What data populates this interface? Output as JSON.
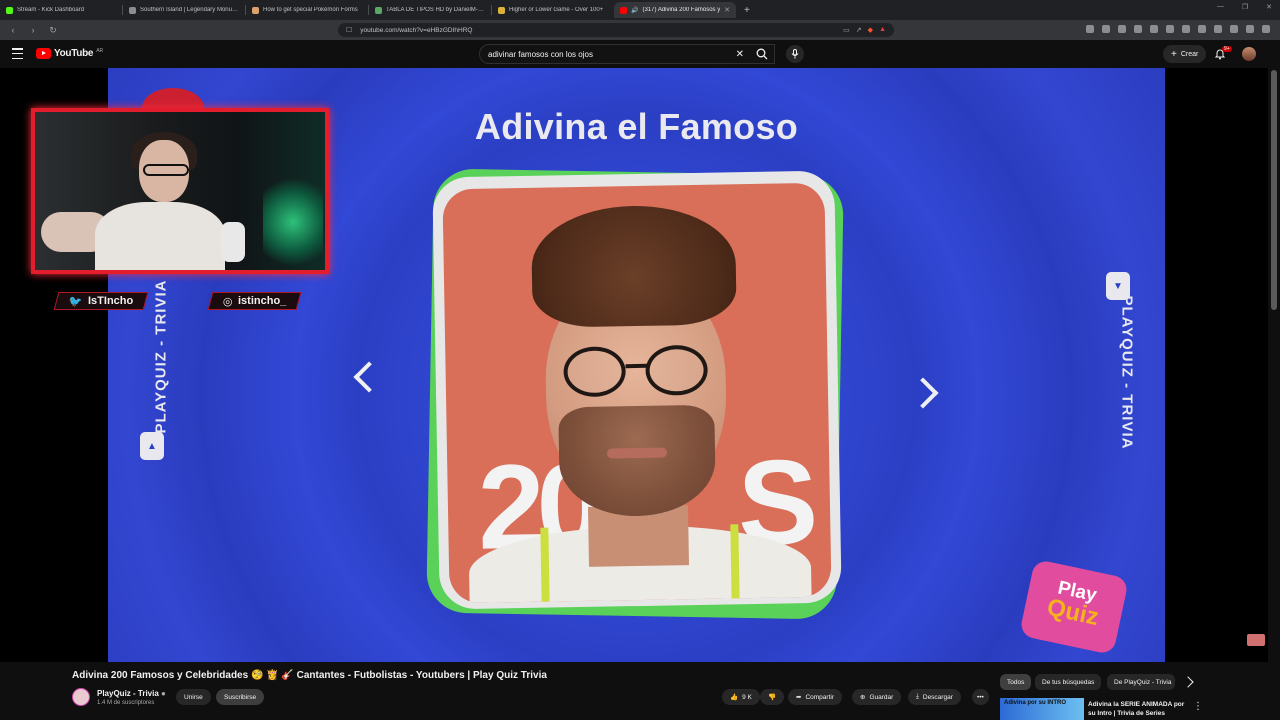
{
  "browser": {
    "tabs": [
      {
        "title": "Stream - Kick Dashboard",
        "color": "#53fc18",
        "active": false
      },
      {
        "title": "Southern Island | Legendary Monum...",
        "color": "#8a8d91",
        "active": false
      },
      {
        "title": "How to get special Pokémon Forms",
        "color": "#d9a36b",
        "active": false
      },
      {
        "title": "TABLA DE TIPOS HD by DanielM-G o",
        "color": "#5aa864",
        "active": false
      },
      {
        "title": "Higher or Lower Game - Over 100+",
        "color": "#ddb23a",
        "active": false
      },
      {
        "title": "(317) Adivina 200 Famosos y",
        "color": "#ff0000",
        "active": true
      }
    ],
    "url": "youtube.com/watch?v=eHBzGDIhHRQ"
  },
  "youtube": {
    "logo_text": "YouTube",
    "region": "AR",
    "search_query": "adivinar famosos con los ojos",
    "create_label": "Crear",
    "notification_count": "9+"
  },
  "video": {
    "title_overlay": "Adivina el Famoso",
    "side_text_left": "PLAYQUIZ - TRIVIA",
    "side_text_right": "PLAYQUIZ - TRIVIA",
    "photo_bg_text_1": "20",
    "photo_bg_text_2": "S",
    "logo_line1": "Play",
    "logo_line2": "Quiz",
    "social_twitter": "IsTIncho",
    "social_instagram": "istincho_",
    "colors": {
      "accent_blue": "#3147d2",
      "frame_green": "#5ad25a",
      "webcam_red": "#e21d2d"
    }
  },
  "below": {
    "video_title": "Adivina 200 Famosos y Celebridades 🧐 👸 🎸 Cantantes - Futbolistas - Youtubers | Play Quiz Trivia",
    "channel_name": "PlayQuiz - Trivia",
    "subscribers": "1.4 M de suscriptores",
    "join_label": "Unirse",
    "subscribe_label": "Suscribirse",
    "likes": "9 K",
    "share_label": "Compartir",
    "save_label": "Guardar",
    "download_label": "Descargar"
  },
  "chips": [
    "Todos",
    "De tus búsquedas",
    "De PlayQuiz - Trivia"
  ],
  "recommended": {
    "thumb_text": "Adivina por su INTRO",
    "title": "Adivina la SERIE ANIMADA por su Intro | Trivia de Series"
  }
}
